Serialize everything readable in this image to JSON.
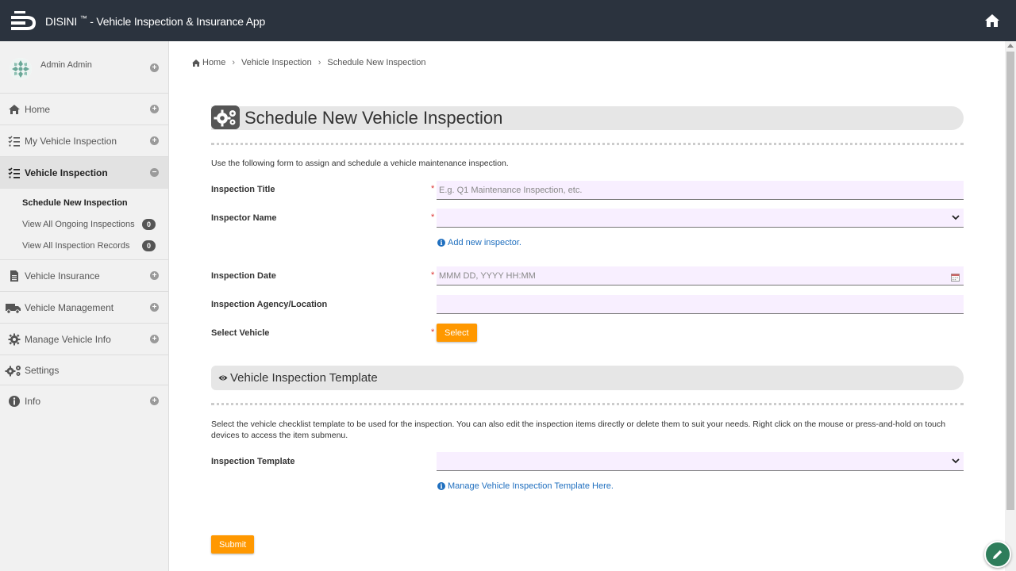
{
  "app": {
    "name": "DISINI",
    "tm": "™",
    "subtitle": " - Vehicle Inspection & Insurance App"
  },
  "user": {
    "name": "Admin Admin"
  },
  "sidebar": {
    "items": [
      {
        "label": "Home",
        "icon": "home-icon"
      },
      {
        "label": "My Vehicle Inspection",
        "icon": "list-check-icon"
      },
      {
        "label": "Vehicle Inspection",
        "icon": "list-check-icon",
        "active": true,
        "sub": [
          {
            "label": "Schedule New Inspection",
            "active": true
          },
          {
            "label": "View All Ongoing Inspections",
            "badge": "0"
          },
          {
            "label": "View All Inspection Records",
            "badge": "0"
          }
        ]
      },
      {
        "label": "Vehicle Insurance",
        "icon": "document-icon"
      },
      {
        "label": "Vehicle Management",
        "icon": "truck-icon"
      },
      {
        "label": "Manage Vehicle Info",
        "icon": "gear-icon"
      },
      {
        "label": "Settings",
        "icon": "gears-icon"
      },
      {
        "label": "Info",
        "icon": "info-icon"
      }
    ]
  },
  "breadcrumb": [
    "Home",
    "Vehicle Inspection",
    "Schedule New Inspection"
  ],
  "form": {
    "title": "Schedule New Vehicle Inspection",
    "description": "Use the following form to assign and schedule a vehicle maintenance inspection.",
    "fields": {
      "inspection_title": {
        "label": "Inspection Title",
        "placeholder": "E.g. Q1 Maintenance Inspection, etc."
      },
      "inspector_name": {
        "label": "Inspector Name",
        "value": ""
      },
      "add_inspector": "Add new inspector.",
      "inspection_date": {
        "label": "Inspection Date",
        "placeholder": "MMM DD, YYYY HH:MM"
      },
      "agency": {
        "label": "Inspection Agency/Location",
        "value": ""
      },
      "select_vehicle": {
        "label": "Select Vehicle",
        "button": "Select"
      }
    },
    "template_section": {
      "title": "Vehicle Inspection Template",
      "description": "Select the vehicle checklist template to be used for the inspection. You can also edit the inspection items directly or delete them to suit your needs. Right click on the mouse or press-and-hold on touch devices to access the item submenu.",
      "template_label": "Inspection Template",
      "manage_link": "Manage Vehicle Inspection Template Here."
    },
    "submit": "Submit"
  },
  "colors": {
    "topbar": "#2b333e",
    "accent": "#ff9800",
    "field_bg": "#f8efff",
    "link": "#1f6fbf"
  }
}
